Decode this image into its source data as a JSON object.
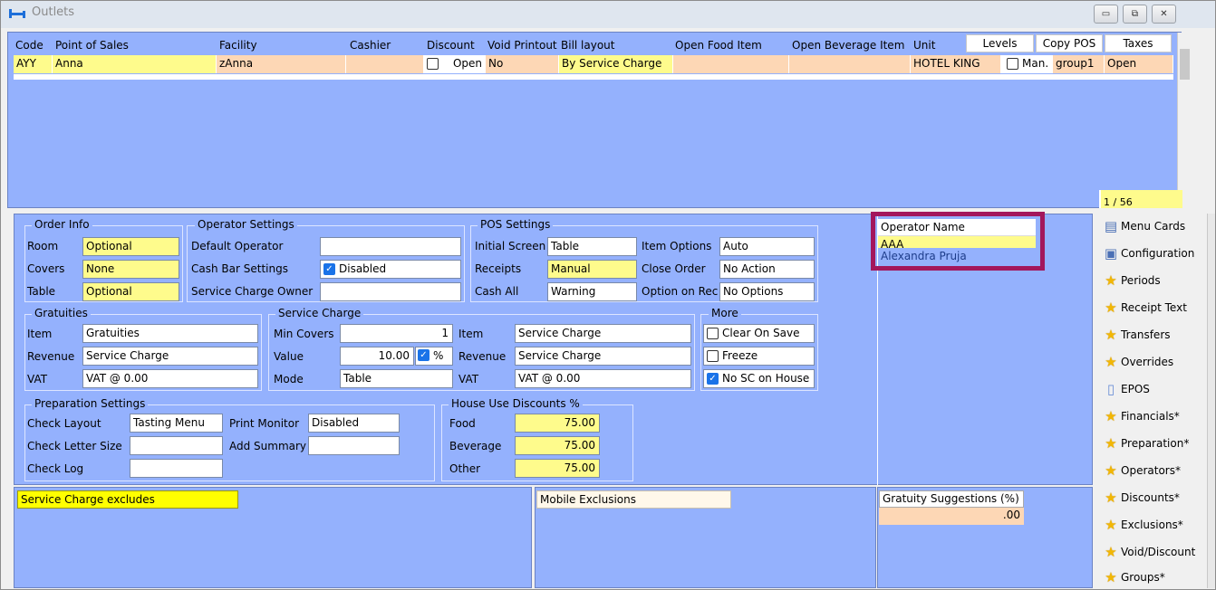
{
  "window": {
    "title": "Outlets",
    "buttons": [
      "▭",
      "⧉",
      "✕"
    ]
  },
  "grid": {
    "headers": [
      "Code",
      "Point of Sales",
      "Facility",
      "Cashier",
      "Discount",
      "Void Printout",
      "Bill layout",
      "Open Food Item",
      "Open Beverage Item",
      "Unit",
      "Levels",
      "Copy POS",
      "Taxes"
    ],
    "row": {
      "code": "AYY",
      "pos": "Anna",
      "facility": "zAnna",
      "cashier": "",
      "discount": "Open",
      "void_printout": "No",
      "bill_layout": "By Service Charge",
      "open_food": "",
      "open_beverage": "",
      "unit": "HOTEL KING",
      "levels": "Man.",
      "copy_pos": "group1",
      "taxes": "Open"
    },
    "pager": "1 / 56"
  },
  "order_info": {
    "title": "Order Info",
    "room_label": "Room",
    "room_value": "Optional",
    "covers_label": "Covers",
    "covers_value": "None",
    "table_label": "Table",
    "table_value": "Optional"
  },
  "operator_settings": {
    "title": "Operator Settings",
    "default_operator_label": "Default Operator",
    "default_operator_value": "",
    "cash_bar_label": "Cash Bar Settings",
    "cash_bar_value": "Disabled",
    "sc_owner_label": "Service Charge Owner",
    "sc_owner_value": ""
  },
  "pos_settings": {
    "title": "POS Settings",
    "initial_screen_label": "Initial Screen",
    "initial_screen_value": "Table",
    "receipts_label": "Receipts",
    "receipts_value": "Manual",
    "cash_all_label": "Cash All",
    "cash_all_value": "Warning",
    "item_options_label": "Item Options",
    "item_options_value": "Auto",
    "close_order_label": "Close Order",
    "close_order_value": "No Action",
    "option_on_rec_label": "Option on Rec",
    "option_on_rec_value": "No Options"
  },
  "gratuities": {
    "title": "Gratuities",
    "item_label": "Item",
    "item_value": "Gratuities",
    "revenue_label": "Revenue",
    "revenue_value": "Service Charge",
    "vat_label": "VAT",
    "vat_value": "VAT @ 0.00"
  },
  "service_charge": {
    "title": "Service Charge",
    "min_covers_label": "Min Covers",
    "min_covers_value": "1",
    "value_label": "Value",
    "value_value": "10.00",
    "pct": "%",
    "mode_label": "Mode",
    "mode_value": "Table",
    "item_label": "Item",
    "item_value": "Service Charge",
    "revenue_label": "Revenue",
    "revenue_value": "Service Charge",
    "vat_label": "VAT",
    "vat_value": "VAT @ 0.00"
  },
  "more": {
    "title": "More",
    "clear_on_save": "Clear On Save",
    "freeze": "Freeze",
    "no_sc_on_house": "No SC on House"
  },
  "preparation": {
    "title": "Preparation Settings",
    "check_layout_label": "Check Layout",
    "check_layout_value": "Tasting Menu",
    "check_letter_size_label": "Check Letter Size",
    "check_letter_size_value": "",
    "check_log_label": "Check Log",
    "check_log_value": "",
    "print_monitor_label": "Print Monitor",
    "print_monitor_value": "Disabled",
    "add_summary_label": "Add Summary",
    "add_summary_value": ""
  },
  "house_use": {
    "title": "House Use Discounts %",
    "food_label": "Food",
    "food_value": "75.00",
    "beverage_label": "Beverage",
    "beverage_value": "75.00",
    "other_label": "Other",
    "other_value": "75.00"
  },
  "operator_list": {
    "header": "Operator Name",
    "selected": "AAA",
    "next": "Alexandra Pruja"
  },
  "bottom": {
    "sc_excludes": "Service Charge excludes",
    "mobile_exclusions": "Mobile Exclusions",
    "gratuity_label": "Gratuity Suggestions (%)",
    "gratuity_value": ".00"
  },
  "sidebar": [
    {
      "label": "Menu Cards",
      "icon": "menu-card-icon"
    },
    {
      "label": "Configuration",
      "icon": "configuration-icon"
    },
    {
      "label": "Periods",
      "icon": "star-icon"
    },
    {
      "label": "Receipt Text",
      "icon": "star-icon"
    },
    {
      "label": "Transfers",
      "icon": "star-icon"
    },
    {
      "label": "Overrides",
      "icon": "star-icon"
    },
    {
      "label": "EPOS",
      "icon": "document-icon"
    },
    {
      "label": "Financials*",
      "icon": "star-icon"
    },
    {
      "label": "Preparation*",
      "icon": "star-icon"
    },
    {
      "label": "Operators*",
      "icon": "star-icon"
    },
    {
      "label": "Discounts*",
      "icon": "star-icon"
    },
    {
      "label": "Exclusions*",
      "icon": "star-icon"
    },
    {
      "label": "Void/Discount",
      "icon": "star-icon"
    },
    {
      "label": "Groups*",
      "icon": "star-icon"
    }
  ],
  "colors": {
    "panel": "#94b1fd",
    "yellow": "#fefb8c",
    "salmon": "#fdd7b5",
    "highlight": "#a3175c"
  }
}
